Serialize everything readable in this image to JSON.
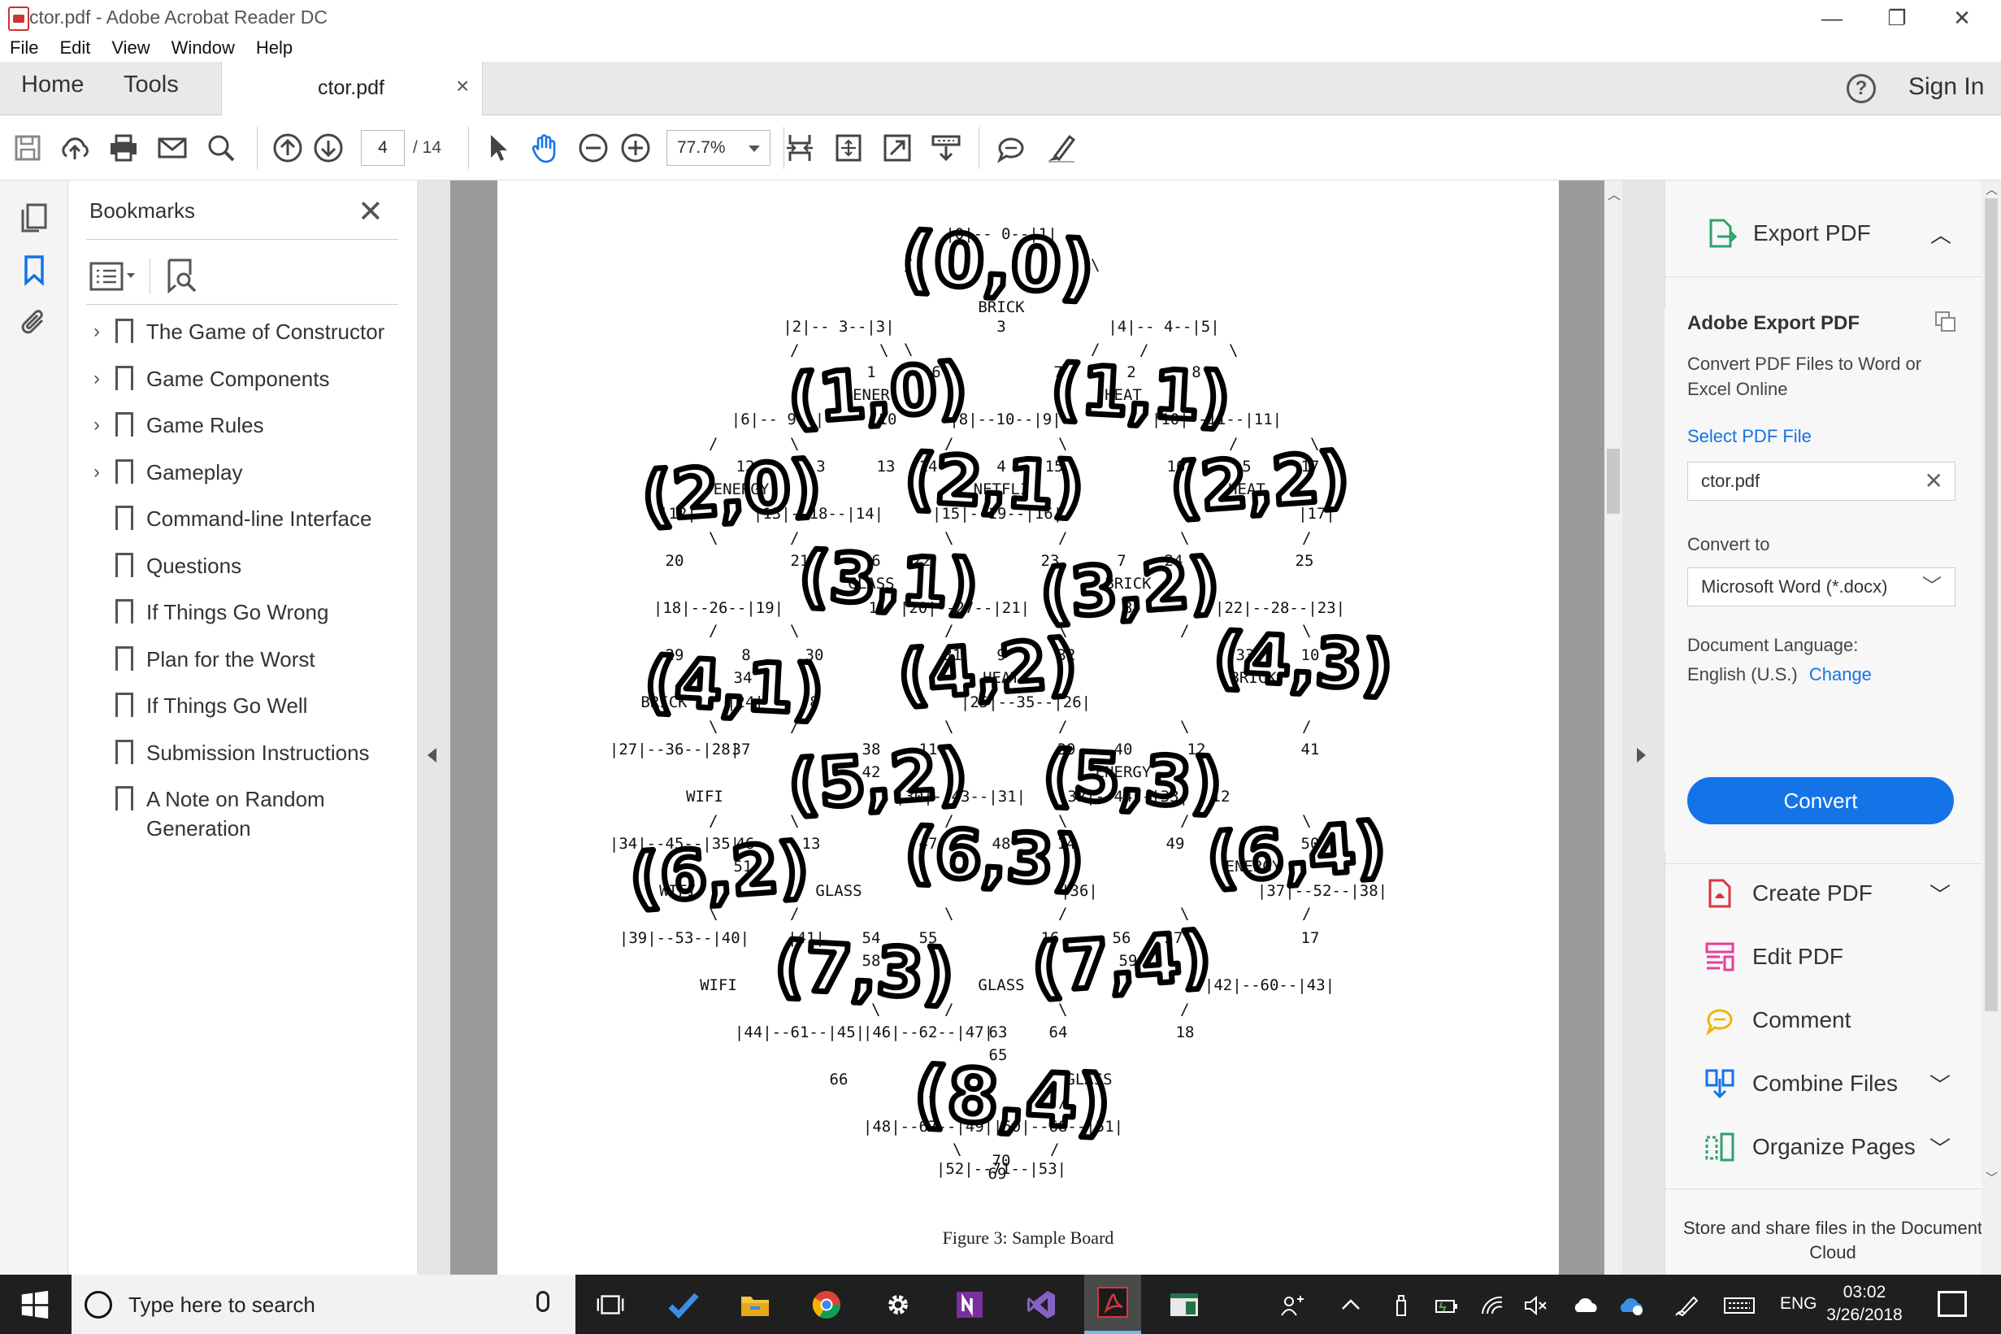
{
  "window": {
    "title": "ctor.pdf - Adobe Acrobat Reader DC",
    "minimize": "—",
    "restore": "❐",
    "close": "✕"
  },
  "menu": [
    "File",
    "Edit",
    "View",
    "Window",
    "Help"
  ],
  "tabs": {
    "home": "Home",
    "tools": "Tools",
    "document": "ctor.pdf",
    "close": "×",
    "help": "?",
    "signin": "Sign In"
  },
  "toolbar": {
    "page_current": "4",
    "page_total": "/ 14",
    "zoom": "77.7%"
  },
  "bookmarks": {
    "title": "Bookmarks",
    "close": "✕",
    "items": [
      {
        "label": "The Game of Constructor",
        "expandable": true
      },
      {
        "label": "Game Components",
        "expandable": true
      },
      {
        "label": "Game Rules",
        "expandable": true
      },
      {
        "label": "Gameplay",
        "expandable": true
      },
      {
        "label": "Command-line Interface",
        "expandable": false
      },
      {
        "label": "Questions",
        "expandable": false
      },
      {
        "label": "If Things Go Wrong",
        "expandable": false
      },
      {
        "label": "Plan for the Worst",
        "expandable": false
      },
      {
        "label": "If Things Go Well",
        "expandable": false
      },
      {
        "label": "Submission Instructions",
        "expandable": false
      },
      {
        "label": "A Note on Random Generation",
        "expandable": false
      }
    ]
  },
  "document": {
    "caption": "Figure 3: Sample Board",
    "board_lines": [
      "|0|-- 0--|1|",
      "/        \\",
      "0  BRICK  1",
      "\\    3    /",
      "|2|-- 3--|3|         |4|-- 4--|5|",
      "/     1     \\        /    2    \\",
      "ENERGY   6     7     HEAT   8",
      "\\    10   /        \\    5    /",
      "|6|-- 9--|7|   |8|--10--|9|  |10|--11--|11|",
      "12     3     13    14     4     15    16     5     17",
      "ENERGY          NETFLIX          HEAT",
      "|12|   |13|--18--|14|   |15|--19--|16|   |17|",
      "20     21     6     22    23     7     24    25",
      "GLASS     BRICK",
      "|18|--26--|19|   |20|--27--|21|   |22|--28--|23|",
      "29     8     30    31     9     32    33     10     34",
      "HEAT       BRICK       BRICK",
      "|24|   |25|--35--|26|   |27|--36--|28|   |29|",
      "37     38    11     39    40     12     41    42",
      "ENERGY     WIFI",
      "|30|--43--|31|   |32|--44--|33|   |34|--45--|35|",
      "46     13     47    48     14     49    50     15     51",
      "ENERGY      WIFI       GLASS",
      "|36|   |37|--52--|38|   |39|--53--|40|   |41|",
      "54     55    16     56    57     17     58    59",
      "|42|--60--|43|   |44|--61--|45|   |46|--62--|47|",
      "63     64     18     65    66",
      "GLASS",
      "|48|--67--|49|   |50|--68--|51|",
      "69     70",
      "|52|--71--|53|"
    ],
    "board_text": [
      {
        "t": "|0|-- 0--|1|"
      },
      {
        "t": "BRICK"
      },
      {
        "t": "3"
      },
      {
        "t": "|2|-- 3--|3|"
      },
      {
        "t": "|4|-- 4--|5|"
      },
      {
        "t": "1"
      },
      {
        "t": "6"
      },
      {
        "t": "7"
      },
      {
        "t": "2"
      },
      {
        "t": "8"
      },
      {
        "t": "ENER"
      },
      {
        "t": "HEAT"
      },
      {
        "t": "|6|-- 9--|"
      },
      {
        "t": "10"
      },
      {
        "t": "|8|--10--|9|"
      },
      {
        "t": "|10|--11--|11|"
      },
      {
        "t": "12"
      },
      {
        "t": "3"
      },
      {
        "t": "13"
      },
      {
        "t": "14"
      },
      {
        "t": "4"
      },
      {
        "t": "15"
      },
      {
        "t": "16"
      },
      {
        "t": "5"
      },
      {
        "t": "17"
      },
      {
        "t": "ENERGY"
      },
      {
        "t": "NETFLI"
      },
      {
        "t": "HEAT"
      },
      {
        "t": "|12|"
      },
      {
        "t": "|13|--18--|14|"
      },
      {
        "t": "|15|--19--|16|"
      },
      {
        "t": "|17|"
      },
      {
        "t": "20"
      },
      {
        "t": "21"
      },
      {
        "t": "6"
      },
      {
        "t": "22"
      },
      {
        "t": "23"
      },
      {
        "t": "7"
      },
      {
        "t": "24"
      },
      {
        "t": "25"
      },
      {
        "t": "GLASS"
      },
      {
        "t": "BRICK"
      },
      {
        "t": "|18|--26--|19|"
      },
      {
        "t": "11"
      },
      {
        "t": "|20|--27--|21|"
      },
      {
        "t": "3"
      },
      {
        "t": "|22|--28--|23|"
      },
      {
        "t": "29"
      },
      {
        "t": "8"
      },
      {
        "t": "30"
      },
      {
        "t": "31"
      },
      {
        "t": "9"
      },
      {
        "t": "32"
      },
      {
        "t": "33"
      },
      {
        "t": "10"
      },
      {
        "t": "34"
      },
      {
        "t": "HEAT"
      },
      {
        "t": "BRICK"
      },
      {
        "t": "BRICK"
      },
      {
        "t": "|24|"
      },
      {
        "t": "8"
      },
      {
        "t": "|25|--35--|26|"
      },
      {
        "t": "|27|--36--|28|"
      },
      {
        "t": "37"
      },
      {
        "t": "38"
      },
      {
        "t": "11"
      },
      {
        "t": "39"
      },
      {
        "t": "40"
      },
      {
        "t": "12"
      },
      {
        "t": "41"
      },
      {
        "t": "42"
      },
      {
        "t": "ENERGY"
      },
      {
        "t": "WIFI"
      },
      {
        "t": "|30|--43--|31|"
      },
      {
        "t": "|32|--44--|33|"
      },
      {
        "t": "12"
      },
      {
        "t": "|34|--45--|35|"
      },
      {
        "t": "46"
      },
      {
        "t": "13"
      },
      {
        "t": "47"
      },
      {
        "t": "48"
      },
      {
        "t": "14"
      },
      {
        "t": "49"
      },
      {
        "t": "50"
      },
      {
        "t": "51"
      },
      {
        "t": "ENERGY"
      },
      {
        "t": "WIFI"
      },
      {
        "t": "GLASS"
      },
      {
        "t": "|36|"
      },
      {
        "t": "|37|--52--|38|"
      },
      {
        "t": "|39|--53--|40|"
      },
      {
        "t": "|41|"
      },
      {
        "t": "54"
      },
      {
        "t": "55"
      },
      {
        "t": "16"
      },
      {
        "t": "56"
      },
      {
        "t": "57"
      },
      {
        "t": "17"
      },
      {
        "t": "58"
      },
      {
        "t": "59"
      },
      {
        "t": "WIFI"
      },
      {
        "t": "GLASS"
      },
      {
        "t": "|42|--60--|43|"
      },
      {
        "t": "|44|--61--|45|"
      },
      {
        "t": "|46|--62--|47|"
      },
      {
        "t": "63"
      },
      {
        "t": "64"
      },
      {
        "t": "18"
      },
      {
        "t": "65"
      },
      {
        "t": "66"
      },
      {
        "t": "GLASS"
      },
      {
        "t": "|48|--67--|49|"
      },
      {
        "t": "|50|--68--|51|"
      },
      {
        "t": "69"
      },
      {
        "t": "70"
      },
      {
        "t": "|52|--71--|53|"
      }
    ],
    "handwriting": [
      "(0,0)",
      "(1,0)",
      "(1,1)",
      "(2,0)",
      "(2,1)",
      "(2,2)",
      "(3,1)",
      "(3,2)",
      "(4,1)",
      "(4,2)",
      "(4,3)",
      "(5,2)",
      "(5,3)",
      "(6,2)",
      "(6,3)",
      "(6,4)",
      "(7,3)",
      "(7,4)",
      "(8,4)"
    ]
  },
  "right_panel": {
    "export_title": "Export PDF",
    "adobe_export": "Adobe Export PDF",
    "description": "Convert PDF Files to Word or Excel Online",
    "select_file": "Select PDF File",
    "file_name": "ctor.pdf",
    "convert_to_label": "Convert to",
    "convert_to_value": "Microsoft Word (*.docx)",
    "doc_lang_label": "Document Language:",
    "doc_lang_value": "English (U.S.)",
    "change": "Change",
    "convert_button": "Convert",
    "tools": [
      "Create PDF",
      "Edit PDF",
      "Comment",
      "Combine Files",
      "Organize Pages"
    ],
    "footer": "Store and share files in the Document Cloud"
  },
  "taskbar": {
    "search_placeholder": "Type here to search",
    "lang": "ENG",
    "time": "03:02",
    "date": "3/26/2018"
  },
  "colors": {
    "accent": "#1473e6",
    "acrobat_red": "#d7373f",
    "taskbar": "#1f1f1f"
  }
}
